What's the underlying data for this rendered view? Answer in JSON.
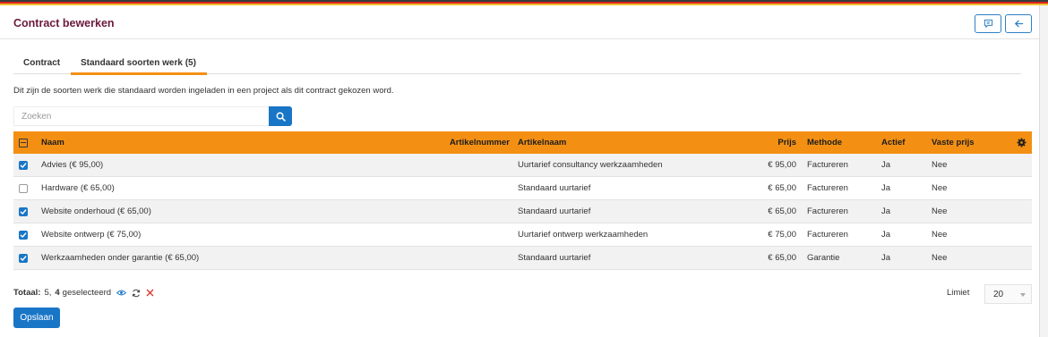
{
  "header": {
    "title": "Contract bewerken",
    "comment_icon": "comment-icon",
    "back_icon": "arrow-left-icon"
  },
  "tabs": [
    {
      "label": "Contract"
    },
    {
      "label": "Standaard soorten werk (5)",
      "active": true
    }
  ],
  "description": "Dit zijn de soorten werk die standaard worden ingeladen in een project als dit contract gekozen word.",
  "search": {
    "placeholder": "Zoeken",
    "value": "",
    "icon": "search-icon"
  },
  "table": {
    "columns": {
      "naam": "Naam",
      "artikelnummer": "Artikelnummer",
      "artikelnaam": "Artikelnaam",
      "prijs": "Prijs",
      "methode": "Methode",
      "actief": "Actief",
      "vaste_prijs": "Vaste prijs"
    },
    "settings_icon": "gear-icon",
    "select_all_state": "indeterminate",
    "rows": [
      {
        "checked": true,
        "naam": "Advies (€ 95,00)",
        "artikelnummer": "",
        "artikelnaam": "Uurtarief consultancy werkzaamheden",
        "prijs": "€ 95,00",
        "methode": "Factureren",
        "actief": "Ja",
        "vaste_prijs": "Nee"
      },
      {
        "checked": false,
        "naam": "Hardware (€ 65,00)",
        "artikelnummer": "",
        "artikelnaam": "Standaard uurtarief",
        "prijs": "€ 65,00",
        "methode": "Factureren",
        "actief": "Ja",
        "vaste_prijs": "Nee"
      },
      {
        "checked": true,
        "naam": "Website onderhoud (€ 65,00)",
        "artikelnummer": "",
        "artikelnaam": "Standaard uurtarief",
        "prijs": "€ 65,00",
        "methode": "Factureren",
        "actief": "Ja",
        "vaste_prijs": "Nee"
      },
      {
        "checked": true,
        "naam": "Website ontwerp (€ 75,00)",
        "artikelnummer": "",
        "artikelnaam": "Uurtarief ontwerp werkzaamheden",
        "prijs": "€ 75,00",
        "methode": "Factureren",
        "actief": "Ja",
        "vaste_prijs": "Nee"
      },
      {
        "checked": true,
        "naam": "Werkzaamheden onder garantie (€ 65,00)",
        "artikelnummer": "",
        "artikelnaam": "Standaard uurtarief",
        "prijs": "€ 65,00",
        "methode": "Garantie",
        "actief": "Ja",
        "vaste_prijs": "Nee"
      }
    ]
  },
  "footer": {
    "total_label": "Totaal:",
    "total_count": "5,",
    "selected_count": "4",
    "selected_label": "geselecteerd",
    "icons": [
      "eye-icon",
      "refresh-icon",
      "clear-selection-icon"
    ],
    "limit_label": "Limiet",
    "limit_value": "20"
  },
  "save_button": "Opslaan",
  "colors": {
    "accent": "#f39014",
    "primary": "#1976c7",
    "title": "#6a1a3a",
    "danger": "#d9261c"
  }
}
